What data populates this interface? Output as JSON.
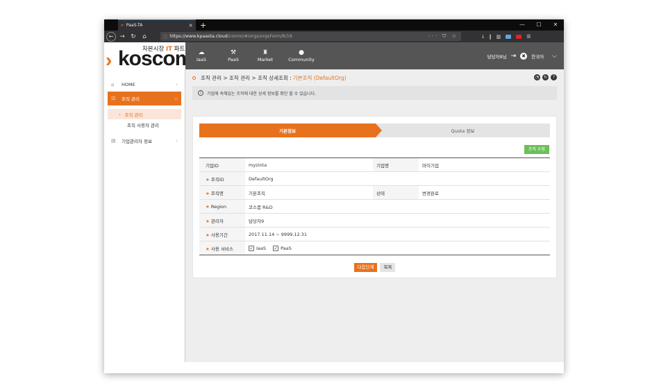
{
  "browser": {
    "tab_title": "PaaS-TA",
    "tab_favicon": "»",
    "new_tab": "+",
    "url_host": "https://www.kpaasta.cloud",
    "url_path": "/comm/#/orgs/orgsForm/R/16",
    "page_actions": "··· ⛉ ☆",
    "minimize": "—",
    "maximize": "☐",
    "close": "✕"
  },
  "header": {
    "logo_sub_prefix": "자본시장",
    "logo_sub_it": "IT",
    "logo_sub_suffix": "파트",
    "logo_mark": "›",
    "logo_text": "koscom",
    "nav": [
      {
        "label": "IaaS",
        "icon": "☁"
      },
      {
        "label": "PaaS",
        "icon": "⚒"
      },
      {
        "label": "Market",
        "icon": "♜"
      },
      {
        "label": "Community",
        "icon": "●"
      }
    ],
    "user_name": "담당자9님",
    "logout_icon": "⇥",
    "language": "한국어",
    "expand_icon": "⌵"
  },
  "sidebar": {
    "items": [
      {
        "label": "HOME",
        "icon": "⌂"
      },
      {
        "label": "조직 관리",
        "icon": "⛫"
      },
      {
        "label": "기업관리자 정보",
        "icon": "▤"
      }
    ],
    "subitems": [
      "조직 관리",
      "조직 사용자 관리"
    ]
  },
  "breadcrumb": {
    "path": "조직 관리 > 조직 관리 > 조직 상세조회 : ",
    "current": "기본조직 (DefaultOrg)"
  },
  "info_message": "기업에 속해있는 조직에 대한 상세 정보를 확인 할 수 있습니다.",
  "steps": {
    "step1": "기본정보",
    "step2": "Quota 정보"
  },
  "edit_button": "조직 수정",
  "form": {
    "company_id_label": "기업ID",
    "company_id": "myzinta",
    "company_name_label": "기업명",
    "company_name": "마이기업",
    "org_id_label": "조직ID",
    "org_id": "DefaultOrg",
    "org_name_label": "조직명",
    "org_name": "기본조직",
    "status_label": "상태",
    "status": "변경완료",
    "region_label": "Region",
    "region": "코스콤 R&D",
    "manager_label": "관리자",
    "manager": "담당자9",
    "period_label": "사용기간",
    "period": "2017.11.14 ~ 9999.12.31",
    "service_label": "사용 서비스",
    "services": [
      "IaaS",
      "PaaS"
    ],
    "required_mark": "★"
  },
  "buttons": {
    "next": "다음단계",
    "list": "목록"
  }
}
